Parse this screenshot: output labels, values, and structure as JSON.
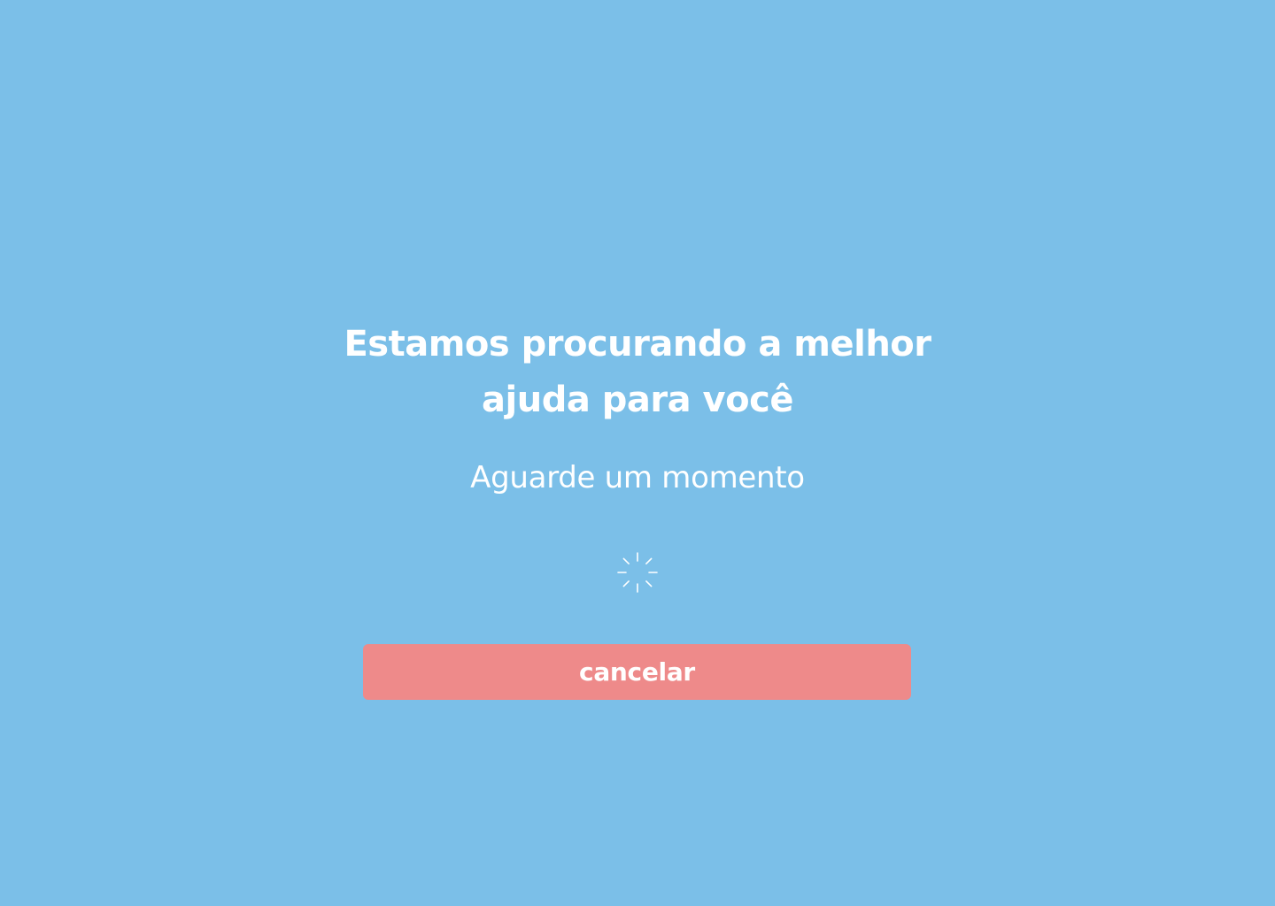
{
  "colors": {
    "background": "#7BBFE8",
    "text": "#FFFFFF",
    "button_bg": "#EE8A8A"
  },
  "loading": {
    "headline_line1": "Estamos procurando a melhor",
    "headline_line2": "ajuda para você",
    "subtitle": "Aguarde um momento",
    "spinner_icon": "loading-spinner-icon"
  },
  "actions": {
    "cancel_label": "cancelar"
  }
}
